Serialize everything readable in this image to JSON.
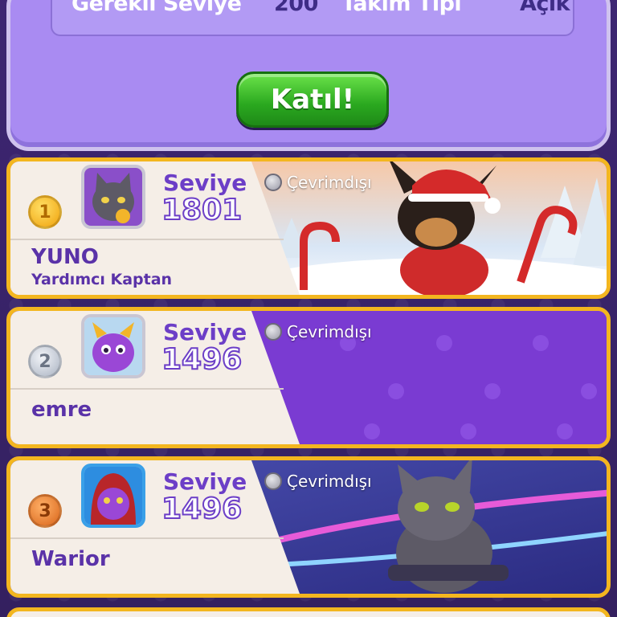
{
  "info": {
    "required_level_label": "Gerekli Seviye",
    "required_level_value": "200",
    "team_type_label": "Takım Tipi",
    "team_type_value": "Açık"
  },
  "join_button": "Katıl!",
  "members": [
    {
      "rank": "1",
      "level_label": "Seviye",
      "level": "1801",
      "name": "YUNO",
      "role": "Yardımcı Kaptan",
      "status": "Çevrimdışı",
      "avatar_icon": "cat-avatar-icon",
      "banner": "christmas-dog"
    },
    {
      "rank": "2",
      "level_label": "Seviye",
      "level": "1496",
      "name": "emre",
      "role": "",
      "status": "Çevrimdışı",
      "avatar_icon": "dragon-avatar-icon",
      "banner": "paw-pattern"
    },
    {
      "rank": "3",
      "level_label": "Seviye",
      "level": "1496",
      "name": "Warior",
      "role": "",
      "status": "Çevrimdışı",
      "avatar_icon": "hooded-dragon-avatar-icon",
      "banner": "racing-cat"
    }
  ],
  "colors": {
    "panel": "#a98bf2",
    "card_border": "#f3b61f",
    "join_green": "#2aa81f",
    "level_purple": "#6c3ec7"
  }
}
